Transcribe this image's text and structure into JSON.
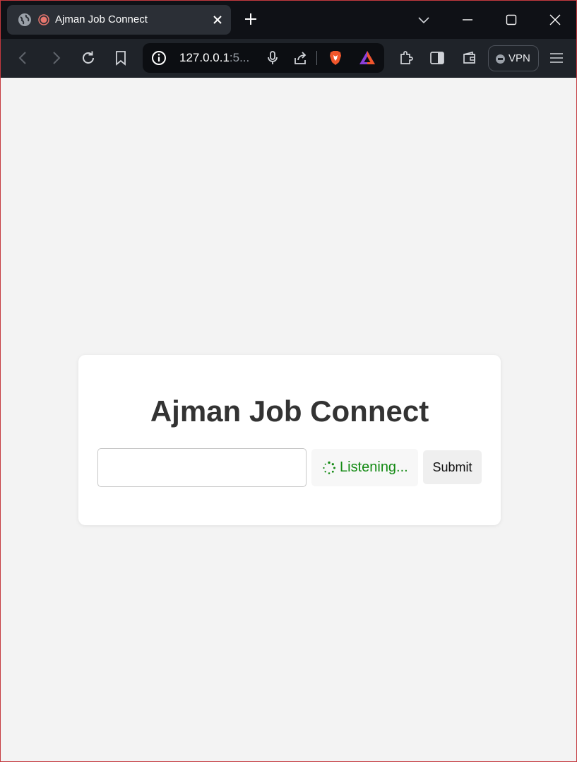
{
  "browser": {
    "tab_title": "Ajman Job Connect",
    "url_host": "127.0.0.1",
    "url_rest": ":5...",
    "vpn_label": "VPN",
    "colors": {
      "tabstrip": "#0f1116",
      "toolbar": "#1f2329",
      "recording": "#e8766e"
    }
  },
  "page": {
    "heading": "Ajman Job Connect",
    "input_value": "",
    "status_text": "Listening...",
    "submit_label": "Submit",
    "colors": {
      "status": "#138a13",
      "heading": "#333333"
    }
  }
}
